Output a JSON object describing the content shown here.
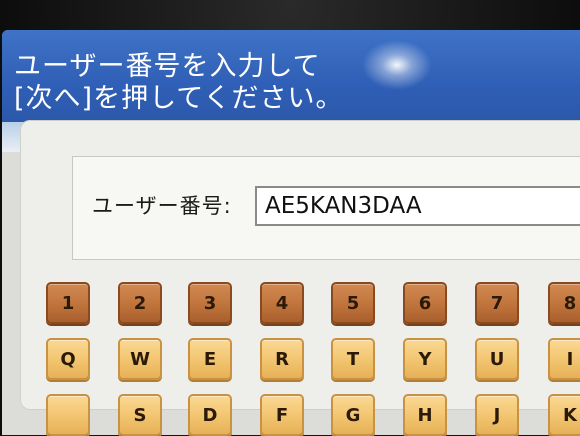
{
  "header": {
    "line1": "ユーザー番号を入力して",
    "line2": "[次へ]を押してください。"
  },
  "form": {
    "user_label": "ユーザー番号:",
    "user_value": "AE5KAN3DAA"
  },
  "keypad": {
    "row1": [
      "1",
      "2",
      "3",
      "4",
      "5",
      "6",
      "7",
      "8"
    ],
    "row2": [
      "Q",
      "W",
      "E",
      "R",
      "T",
      "Y",
      "U",
      "I"
    ],
    "row3": [
      "",
      "S",
      "D",
      "F",
      "G",
      "H",
      "J",
      "K"
    ]
  }
}
